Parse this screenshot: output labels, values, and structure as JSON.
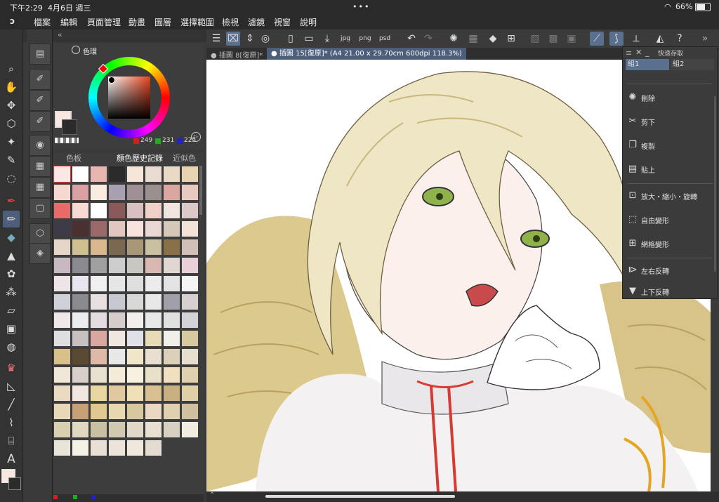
{
  "status": {
    "time": "下午2:29",
    "date": "4月6日 週三",
    "battery": "66%"
  },
  "menu": [
    "檔案",
    "編輯",
    "頁面管理",
    "動畫",
    "圖層",
    "選擇範圍",
    "檢視",
    "濾鏡",
    "視窗",
    "說明"
  ],
  "color_panel": {
    "title": "色環",
    "rgb": {
      "r": "249",
      "g": "231",
      "b": "225"
    },
    "main_color": "#f9e7e1",
    "sub_color": "#2b2b2b"
  },
  "swatch_panel": {
    "tabs": [
      "色板",
      "顏色歷史記錄",
      "近似色"
    ],
    "active_tab": 1,
    "swatches": [
      "#fbe8e5",
      "#ffffff",
      "#e8b6b0",
      "#2a2a2a",
      "#f5e6d8",
      "#eadbd2",
      "#e9d9c5",
      "#e8d4b0",
      "#f5d8d0",
      "#d8a0a0",
      "#f8ede0",
      "#a8a0b0",
      "#9e9094",
      "#9a9090",
      "#dba5a0",
      "#e9c8c0",
      "#ea6a6a",
      "#f8d9d3",
      "#ffffff",
      "#8a5a5a",
      "#d8c0c0",
      "#f0d0c8",
      "#efe4e0",
      "#dcc8c8",
      "#3e3a48",
      "#4a3030",
      "#9a6a6a",
      "#e0c8c0",
      "#f8e2de",
      "#ead8d4",
      "#d6c8b8",
      "#f2e2d8",
      "#e6d6c8",
      "#cfc090",
      "#d9b890",
      "#7a6850",
      "#a89878",
      "#c8c0a0",
      "#8a7048",
      "#d0c0b8",
      "#c8b8c0",
      "#8a8a90",
      "#a0a0a0",
      "#cccccc",
      "#c8c8c0",
      "#d8b8b0",
      "#e0d8d0",
      "#e8d0d8",
      "#eee6e6",
      "#e8e4f0",
      "#f0f0f0",
      "#e6e6e6",
      "#dedede",
      "#ececec",
      "#e4e4e4",
      "#f4f4f4",
      "#d0d0d8",
      "#8a8a90",
      "#e8e0e0",
      "#c8c8d0",
      "#d8d8d8",
      "#e8e8e8",
      "#a0a0a8",
      "#d8d0d0",
      "#f0e8e8",
      "#ececf0",
      "#e4dce0",
      "#d6cccc",
      "#f2eeee",
      "#e8e8e8",
      "#e0e0e0",
      "#d4d4d8",
      "#dedee0",
      "#c8c0c0",
      "#d8a8a0",
      "#f0e8e0",
      "#e0e0e8",
      "#e8dcb8",
      "#f0f0e8",
      "#d8c8a0",
      "#d8c088",
      "#5a4a30",
      "#e0b8a8",
      "#e8e8e8",
      "#f0e6c8",
      "#e8dfd0",
      "#dcd0b8",
      "#e6dfd0",
      "#f0e6d8",
      "#d8d0c8",
      "#e8e0d0",
      "#f4ecd8",
      "#f8f0e0",
      "#e8e0c8",
      "#f0e0c0",
      "#e0d0b0",
      "#eadac0",
      "#f0e8e0",
      "#e8d6a0",
      "#e0c8a0",
      "#f0e0b8",
      "#d8c090",
      "#c8b080",
      "#e0d0a8",
      "#e8d8b8",
      "#c8a078",
      "#e0c890",
      "#e8d8b0",
      "#d8c8a0",
      "#ead8c0",
      "#e0d0b0",
      "#d0c0a0",
      "#d8d0b0",
      "#e0d8c0",
      "#c8c0a0",
      "#d0c8b0",
      "#e0d8c8",
      "#e8e0d0",
      "#d8d0c0",
      "#f0ece0",
      "#e8e4d8",
      "#f4f0e4",
      "#e8e0d4",
      "#ece4d8",
      "#f0e8dc",
      "#e4dcd0"
    ]
  },
  "doc_tabs": [
    "插圖 8[復原]*",
    "插圖 15[復原]* (A4 21.00 x 29.70cm 600dpi 118.3%)"
  ],
  "quick_access": {
    "title": "快速存取",
    "sets": [
      "組1",
      "組2"
    ],
    "items": [
      {
        "label": "刪除",
        "icon": "dotted-circle-icon"
      },
      {
        "label": "剪下",
        "icon": "scissors-icon"
      },
      {
        "label": "複製",
        "icon": "copy-icon"
      },
      {
        "label": "貼上",
        "icon": "paste-icon"
      },
      {
        "label": "放大・縮小・旋轉",
        "icon": "transform-icon"
      },
      {
        "label": "自由變形",
        "icon": "free-transform-icon"
      },
      {
        "label": "網格變形",
        "icon": "mesh-transform-icon"
      },
      {
        "label": "左右反轉",
        "icon": "flip-horizontal-icon"
      },
      {
        "label": "上下反轉",
        "icon": "flip-vertical-icon"
      }
    ]
  },
  "colors": {
    "accent": "#5b6f8f",
    "panel": "#3d3d3d",
    "dark": "#2a2a2a"
  }
}
